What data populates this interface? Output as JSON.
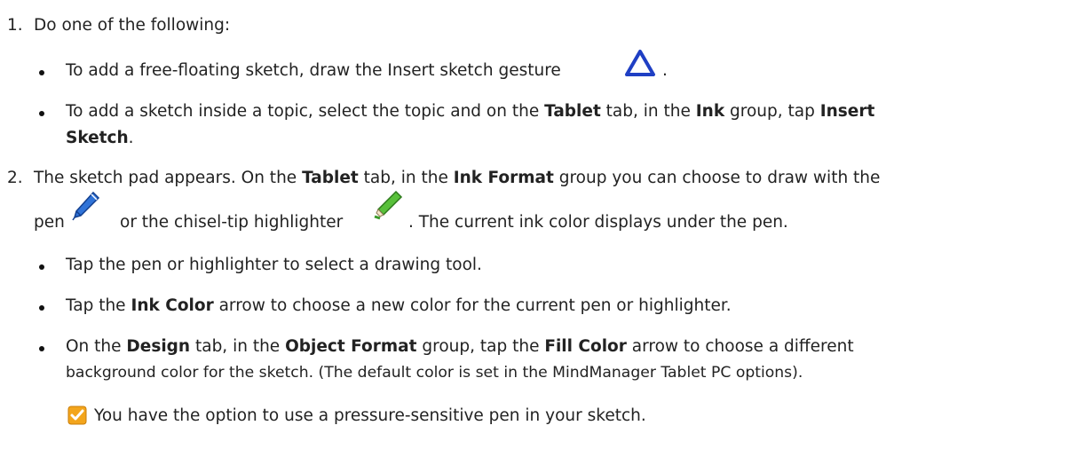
{
  "steps": [
    {
      "number": "1.",
      "text": "Do one of the following:",
      "bullets": [
        {
          "a": "To add a free-floating sketch, draw the Insert sketch gesture",
          "b": "."
        },
        {
          "a": "To add a sketch inside a topic, select the topic and on the ",
          "b1": "Tablet",
          "c": " tab, in the ",
          "b2": "Ink",
          "d": " group, tap ",
          "b3": "Insert",
          "b4": "Sketch",
          "e": "."
        }
      ]
    },
    {
      "number": "2.",
      "p1": {
        "a": "The sketch pad appears. On the ",
        "b1": "Tablet",
        "c": " tab, in the ",
        "b2": "Ink Format",
        "d": " group you can choose to draw with the"
      },
      "p2": {
        "a": "pen",
        "b": "or the chisel-tip highlighter",
        "c": ". The current ink color displays under the pen."
      },
      "bullets": [
        {
          "a": "Tap the pen or highlighter to select a drawing tool."
        },
        {
          "a": "Tap the ",
          "b": "Ink Color",
          "c": " arrow to choose a new color for the current pen or highlighter."
        },
        {
          "a": "On the ",
          "b1": "Design",
          "c": " tab, in the ",
          "b2": "Object Format",
          "d": " group, tap the ",
          "b3": "Fill Color",
          "e": " arrow to choose a different",
          "f": "background color for the sketch. (The default color is set in the MindManager Tablet PC options)."
        }
      ],
      "tip": "You have the option to use a pressure-sensitive pen in your sketch."
    }
  ]
}
